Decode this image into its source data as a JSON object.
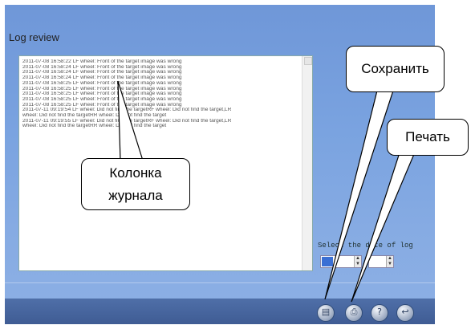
{
  "window": {
    "title": "Log review"
  },
  "log": {
    "lines": [
      "2011-07-08 16:58:22 LF wheel: Front of the target image was wrong",
      "2011-07-08 16:58:24 LF wheel: Front of the target image was wrong",
      "2011-07-08 16:58:24 LF wheel: Front of the target image was wrong",
      "2011-07-08 16:58:24 LF wheel: Front of the target image was wrong",
      "2011-07-08 16:58:25 LF wheel: Front of the target image was wrong",
      "2011-07-08 16:58:25 LF wheel: Front of the target image was wrong",
      "2011-07-08 16:58:25 LF wheel: Front of the target image was wrong",
      "2011-07-08 16:58:25 LF wheel: Front of the target image was wrong",
      "2011-07-08 16:58:25 LF wheel: Front of the target image was wrong",
      "2011-07-11 09:19:54 LF wheel: Did not find the targetRF wheel: Did not find the target,LR",
      "wheel: Did not find the targetRR wheel: Did not find the target",
      "2011-07-11 09:19:55 LF wheel: Did not find the targetRF wheel: Did not find the target,LR",
      "wheel: Did not find the targetRR wheel: Did not find the target"
    ]
  },
  "date_select": {
    "label": "Select the date of log",
    "from_value": "",
    "to_value": ""
  },
  "toolbar": {
    "buttons": [
      {
        "icon": "save-icon"
      },
      {
        "icon": "print-icon"
      },
      {
        "icon": "help-icon"
      },
      {
        "icon": "exit-icon"
      }
    ]
  },
  "callouts": {
    "save": "Сохранить",
    "print": "Печать",
    "column": "Колонка\nжурнала"
  },
  "colors": {
    "window_bg": "#7aa3e0",
    "footer_bg": "#3f5c94"
  }
}
